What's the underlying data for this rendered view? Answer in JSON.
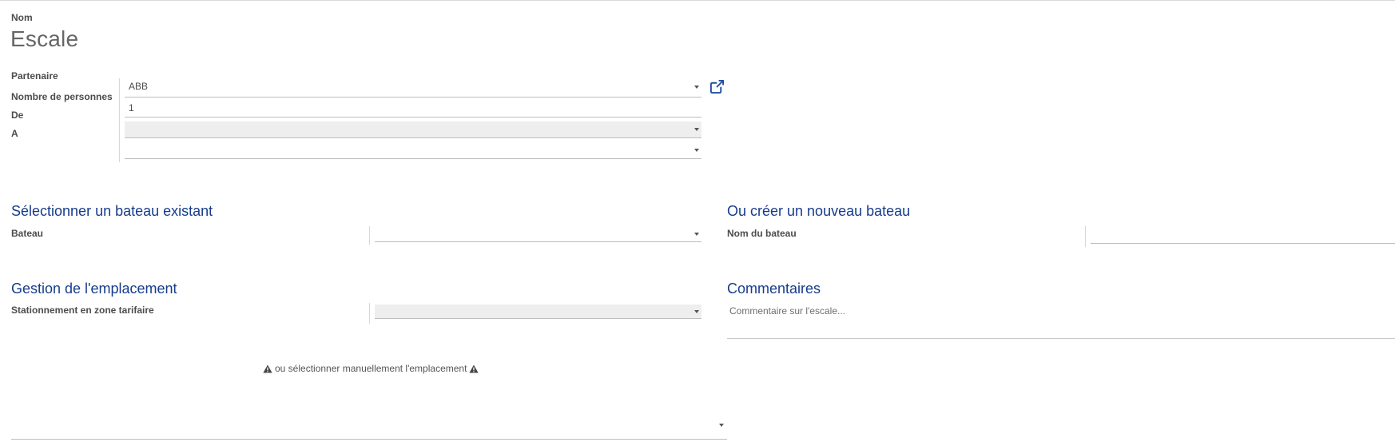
{
  "form": {
    "name_label": "Nom",
    "name_value": "Escale",
    "partner": {
      "label": "Partenaire",
      "value": "ABB"
    },
    "persons": {
      "label": "Nombre de personnes",
      "value": "1"
    },
    "from": {
      "label": "De",
      "value": ""
    },
    "to": {
      "label": "A",
      "value": ""
    }
  },
  "boat_select": {
    "title": "Sélectionner un bateau existant",
    "label": "Bateau",
    "value": ""
  },
  "boat_create": {
    "title": "Ou créer un nouveau bateau",
    "label": "Nom du bateau",
    "value": ""
  },
  "location": {
    "title": "Gestion de l'emplacement",
    "label": "Stationnement en zone tarifaire",
    "value": "",
    "manual_note": "ou sélectionner manuellement l'emplacement",
    "manual_value": ""
  },
  "comments": {
    "title": "Commentaires",
    "placeholder": "Commentaire sur l'escale..."
  },
  "colors": {
    "section_title": "#163c8c",
    "link_icon": "#1f4ea0",
    "readonly_bg": "#eeeeee"
  },
  "icons": {
    "external_link": "external-link-icon",
    "warning": "warning-icon",
    "dropdown": "caret-down-icon"
  }
}
